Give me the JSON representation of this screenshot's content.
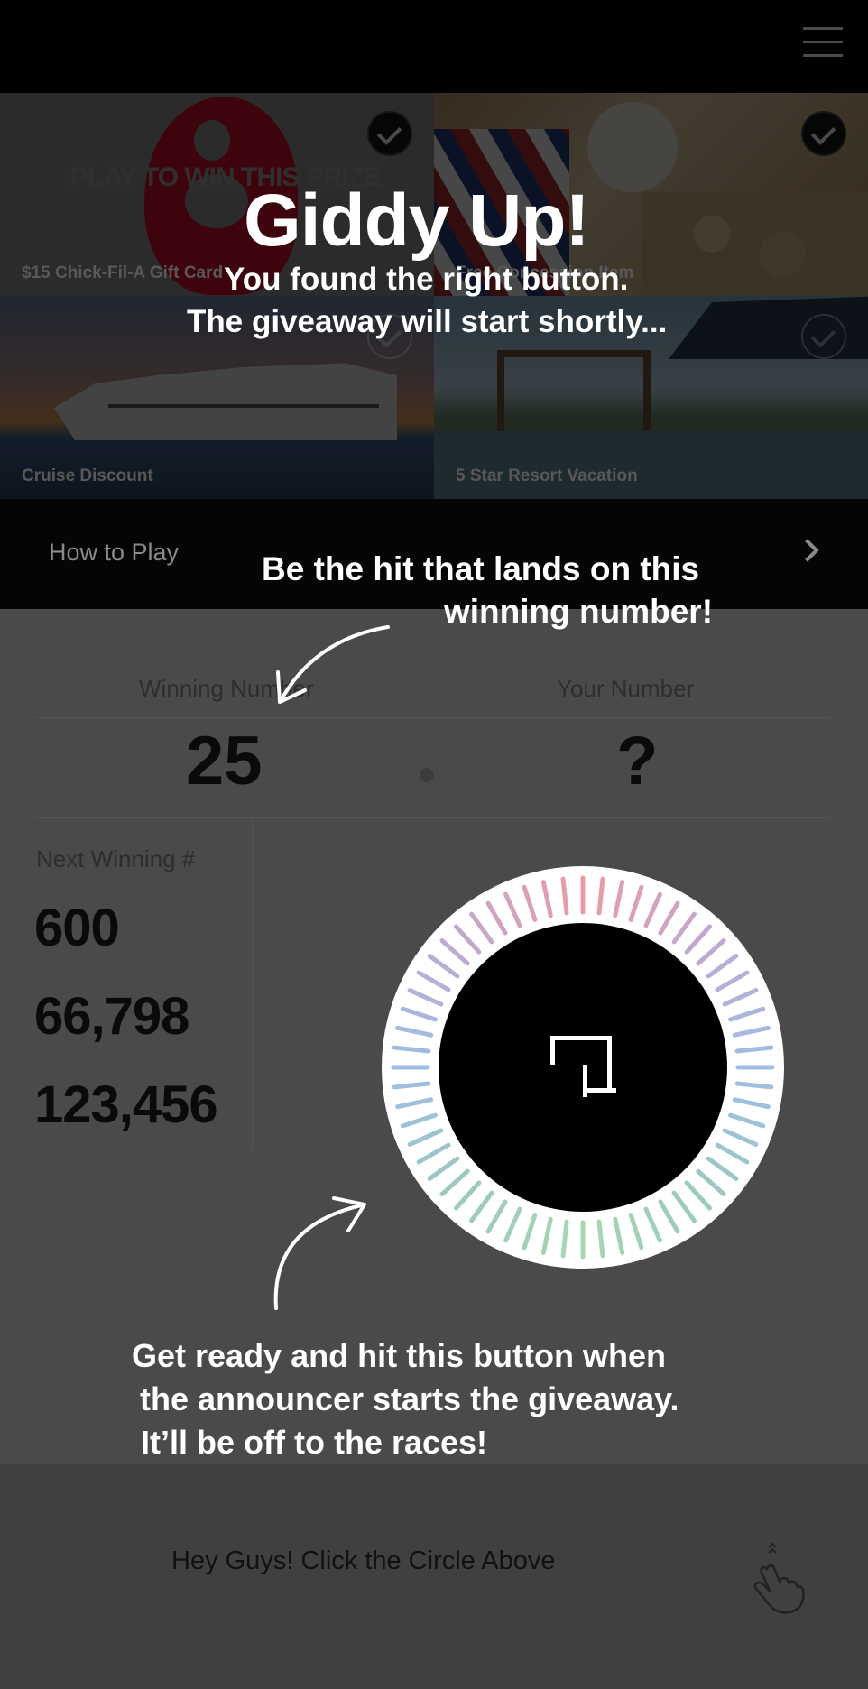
{
  "header": {
    "menu_icon": "hamburger-menu-icon"
  },
  "prizes": [
    {
      "name": "$15 Chick-Fil-A Gift Card",
      "overlay_text": "PLAY TO WIN THIS PRIZE",
      "selected": true
    },
    {
      "name": "Free Concession Item",
      "selected": true
    },
    {
      "name": "Cruise Discount",
      "selected": false
    },
    {
      "name": "5 Star Resort Vacation",
      "selected": false
    }
  ],
  "how_to_play": {
    "label": "How to Play",
    "icon": "chevron-right-icon"
  },
  "game": {
    "winning_label": "Winning Number",
    "your_label": "Your Number",
    "winning_number": "25",
    "your_number": "?",
    "next_label": "Next Winning #",
    "next_numbers": [
      "600",
      "66,798",
      "123,456"
    ]
  },
  "circle_button": {
    "ring_colors": [
      "#e88a95",
      "#b59bc9",
      "#8fb3e0",
      "#8cc0b5",
      "#98d0a3"
    ]
  },
  "bottom_bar": {
    "text": "Hey Guys! Click the Circle Above",
    "icon": "tap-hand-icon"
  },
  "overlay": {
    "title": "Giddy Up!",
    "subtitle_line1": "You found the right button.",
    "subtitle_line2": "The giveaway will start shortly...",
    "hint_line1": "Be the hit that lands on this",
    "hint_line2": "winning number!",
    "ready_line1": "Get ready and hit this button when",
    "ready_line2": "the  announcer starts the giveaway.",
    "ready_line3": "It’ll be off to the races!"
  }
}
